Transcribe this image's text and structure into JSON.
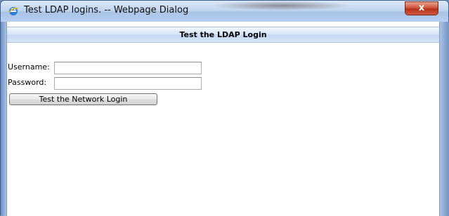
{
  "window": {
    "title": "Test LDAP logins. -- Webpage Dialog",
    "close_label": "x",
    "icon": "ie-icon"
  },
  "header": {
    "title": "Test the LDAP Login"
  },
  "form": {
    "username_label": "Username:",
    "username_value": "",
    "password_label": "Password:",
    "password_value": "",
    "submit_label": "Test the Network Login"
  }
}
